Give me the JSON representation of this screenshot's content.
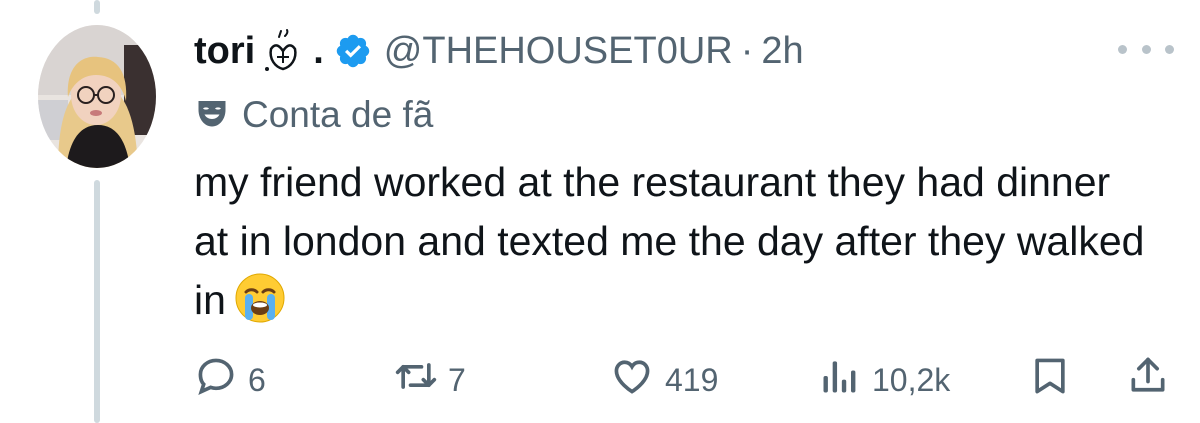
{
  "tweet": {
    "author_name": "tori",
    "author_name_suffix": ".",
    "handle": "@THEHOUSET0UR",
    "separator": "·",
    "time": "2h",
    "account_label": "Conta de fã",
    "text": "my friend worked at the restaurant they had dinner at in london and texted me the day after they walked in",
    "emoji": "loudly-crying-face"
  },
  "actions": {
    "replies": "6",
    "reposts": "7",
    "likes": "419",
    "views": "10,2k"
  },
  "colors": {
    "verified": "#1d9bf0",
    "muted": "#536471",
    "text": "#0f1419",
    "thread_line": "#cfd9de"
  },
  "icons": [
    "reply-icon",
    "repost-icon",
    "like-icon",
    "views-icon",
    "bookmark-icon",
    "share-icon",
    "verified-badge-icon",
    "fan-account-icon",
    "more-icon"
  ]
}
